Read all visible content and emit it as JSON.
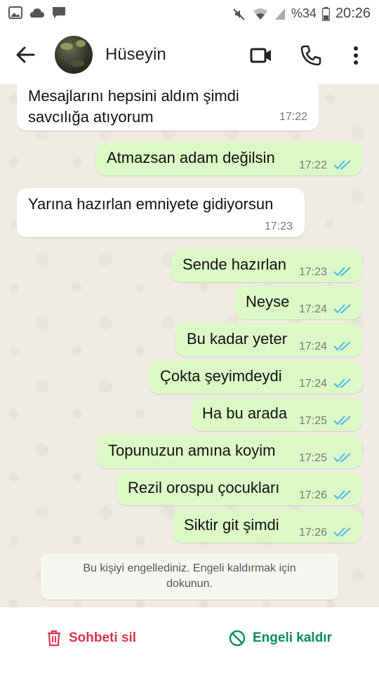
{
  "status_bar": {
    "battery": "%34",
    "time": "20:26"
  },
  "header": {
    "contact_name": "Hüseyin"
  },
  "messages": [
    {
      "dir": "in",
      "text": "Mesajlarını hepsini aldım şimdi\nsavcılığa atıyorum",
      "time": "17:22"
    },
    {
      "dir": "out",
      "text": "Atmazsan adam değilsin",
      "time": "17:22"
    },
    {
      "dir": "in",
      "text": "Yarına hazırlan emniyete gidiyorsun",
      "time": "17:23"
    },
    {
      "dir": "out",
      "text": "Sende hazırlan",
      "time": "17:23"
    },
    {
      "dir": "out",
      "text": "Neyse",
      "time": "17:24"
    },
    {
      "dir": "out",
      "text": "Bu kadar yeter",
      "time": "17:24"
    },
    {
      "dir": "out",
      "text": "Çokta şeyimdeydi",
      "time": "17:24"
    },
    {
      "dir": "out",
      "text": "Ha bu arada",
      "time": "17:25"
    },
    {
      "dir": "out",
      "text": "Topunuzun amına koyim",
      "time": "17:25"
    },
    {
      "dir": "out",
      "text": "Rezil orospu çocukları",
      "time": "17:26"
    },
    {
      "dir": "out",
      "text": "Siktir git şimdi",
      "time": "17:26"
    }
  ],
  "notice": {
    "line1": "Bu kişiyi engellediniz. Engeli kaldırmak için",
    "line2": "dokunun."
  },
  "bottom_bar": {
    "delete_label": "Sohbeti sil",
    "unblock_label": "Engeli kaldır"
  },
  "colors": {
    "outgoing_bubble": "#dcf8c6",
    "incoming_bubble": "#ffffff",
    "read_ticks": "#4fb6ec",
    "delete_red": "#d9354f",
    "unblock_green": "#0a8a62"
  },
  "icons": {
    "status_left": [
      "image-icon",
      "cloud-icon",
      "message-icon"
    ],
    "status_right": [
      "mute-icon",
      "wifi-icon",
      "signal-icon",
      "battery-icon"
    ],
    "header": [
      "back-arrow-icon",
      "video-call-icon",
      "phone-icon",
      "more-vert-icon"
    ],
    "bottom": [
      "trash-icon",
      "block-icon"
    ]
  }
}
